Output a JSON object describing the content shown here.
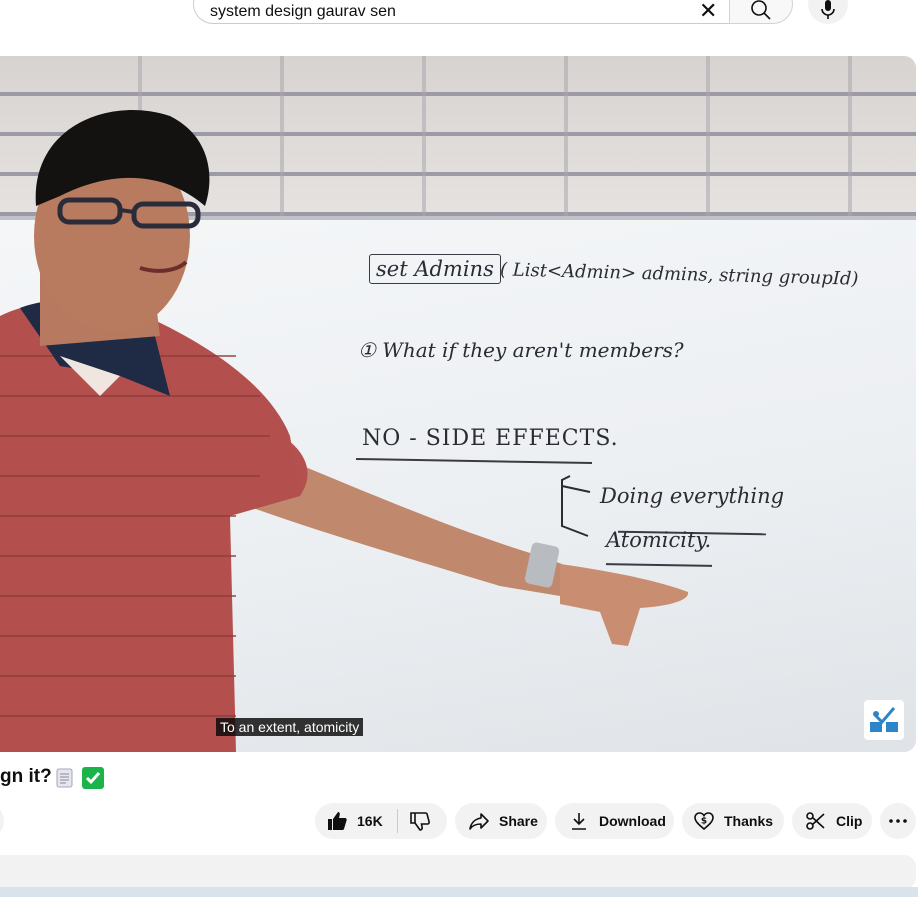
{
  "search": {
    "query": "system design gaurav sen"
  },
  "video": {
    "caption": "To an extent, atomicity",
    "board": {
      "line1_box": "set Admins",
      "line1_rest": "( List<Admin> admins, string groupId)",
      "line2": "① What if they aren't members?",
      "line3": "NO - SIDE EFFECTS.",
      "line4": "Doing everything",
      "line5": "Atomicity."
    }
  },
  "title": {
    "text": "gn it?"
  },
  "actions": {
    "like_count": "16K",
    "share_label": "Share",
    "download_label": "Download",
    "thanks_label": "Thanks",
    "clip_label": "Clip"
  },
  "icons": {
    "search": "search-icon",
    "clear": "close-icon",
    "mic": "mic-icon",
    "like": "thumbs-up-icon",
    "dislike": "thumbs-down-icon",
    "share": "share-icon",
    "download": "download-icon",
    "thanks": "thanks-heart-icon",
    "clip": "scissors-icon",
    "more": "more-horizontal-icon"
  },
  "colors": {
    "pill_bg": "#f2f2f2",
    "caption_bg": "#080808",
    "check_green": "#1cb44a"
  }
}
